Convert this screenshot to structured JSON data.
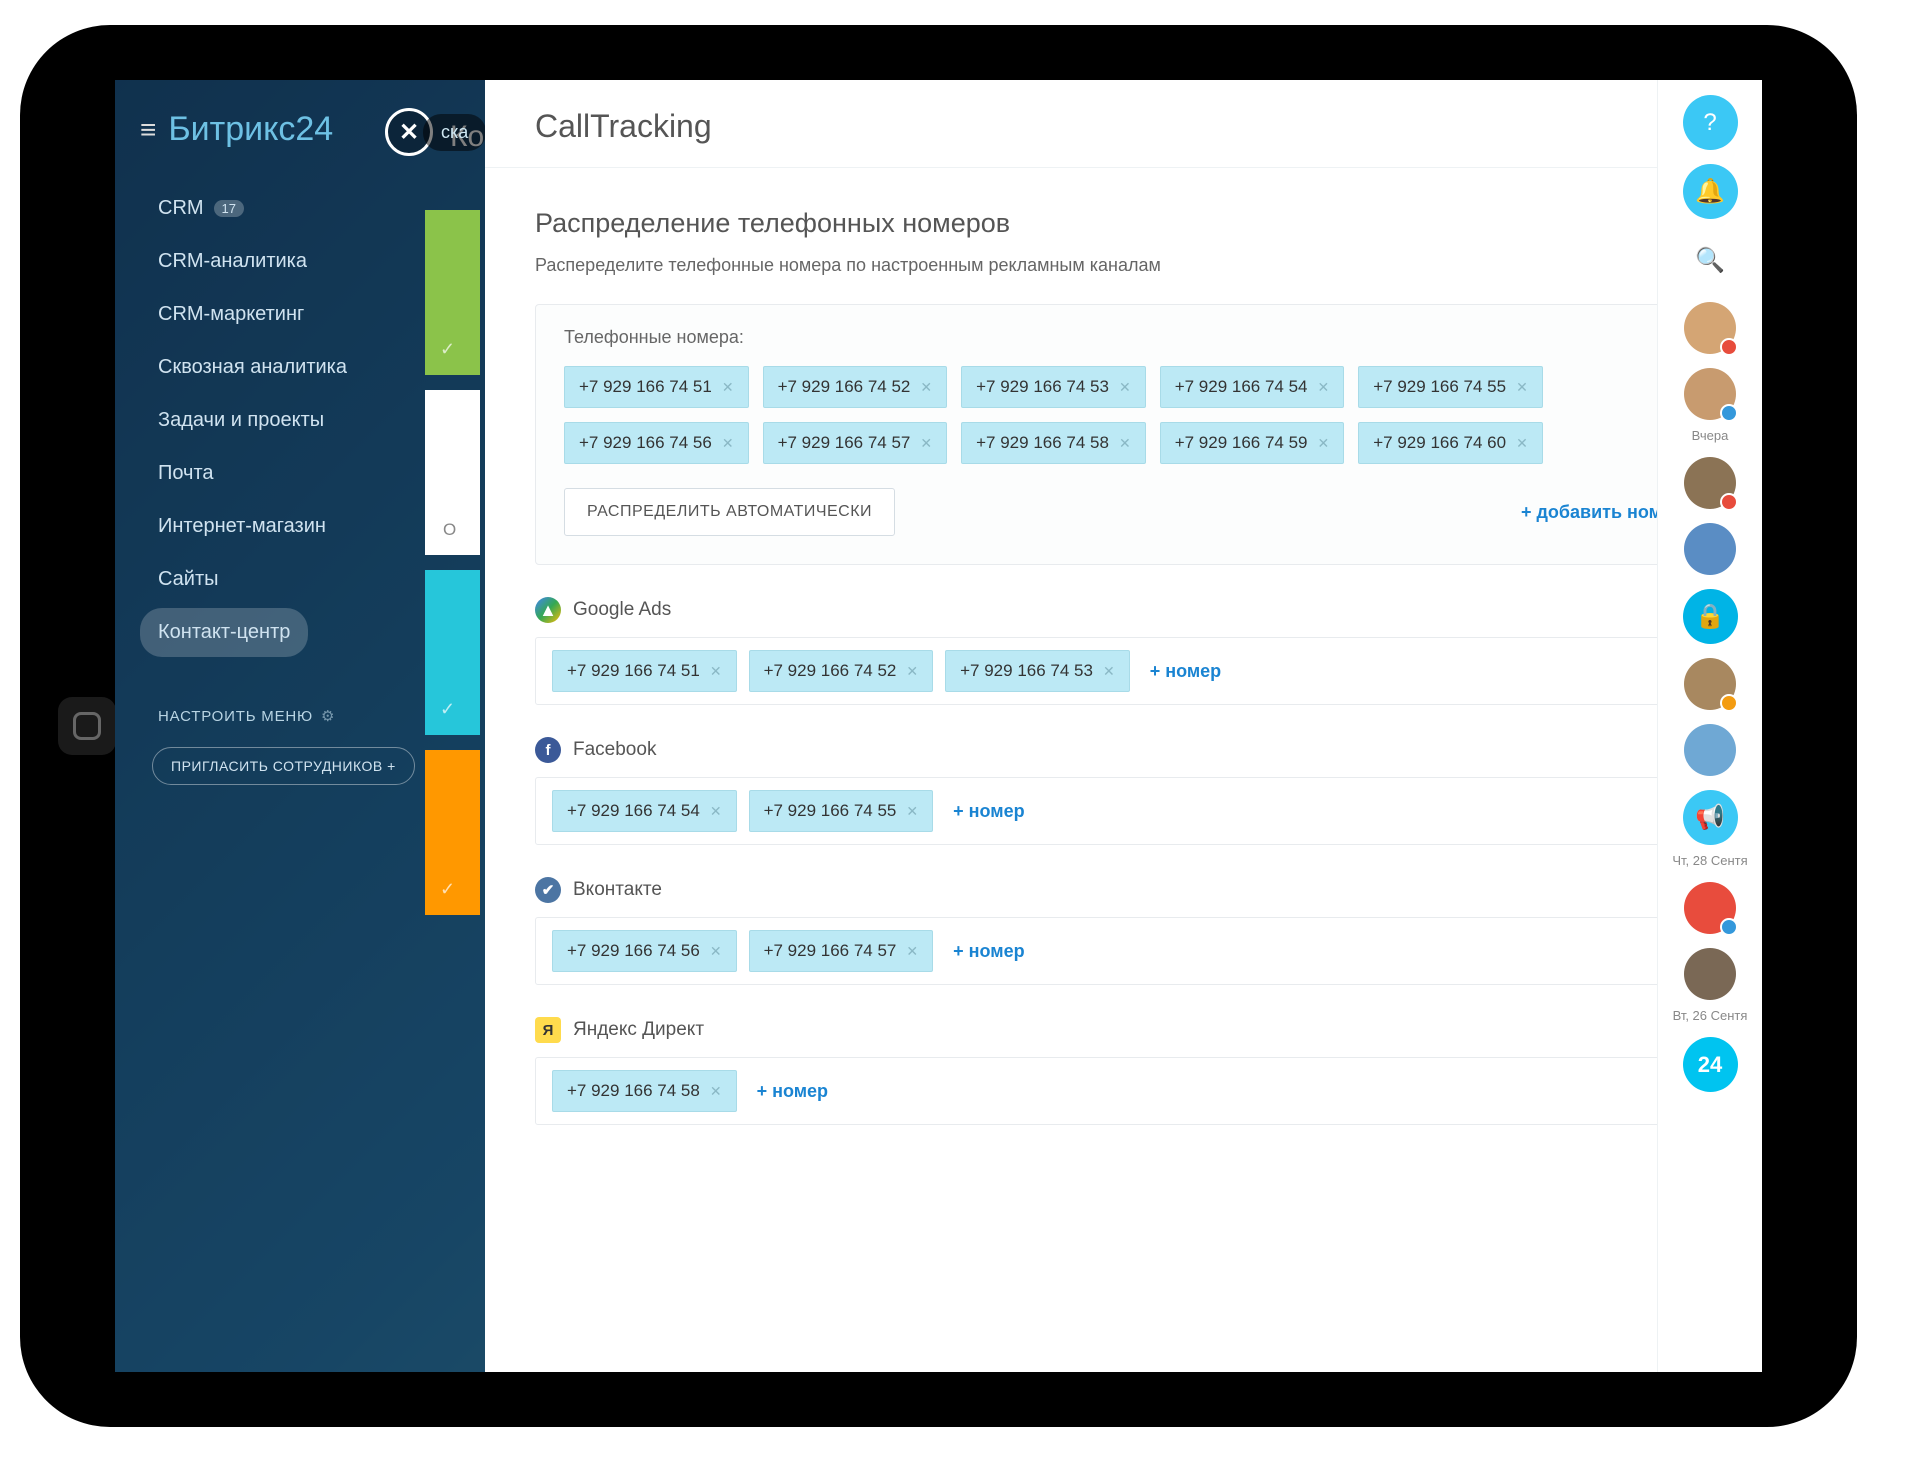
{
  "logo": {
    "brand": "Битрикс",
    "num": "24"
  },
  "nav": [
    {
      "label": "CRM",
      "badge": "17"
    },
    {
      "label": "CRM-аналитика"
    },
    {
      "label": "CRM-маркетинг"
    },
    {
      "label": "Сквозная аналитика"
    },
    {
      "label": "Задачи и проекты"
    },
    {
      "label": "Почта"
    },
    {
      "label": "Интернет-магазин"
    },
    {
      "label": "Сайты"
    },
    {
      "label": "Контакт-центр",
      "active": true
    }
  ],
  "sidebar": {
    "settings": "НАСТРОИТЬ МЕНЮ",
    "invite": "ПРИГЛАСИТЬ СОТРУДНИКОВ +"
  },
  "mid": {
    "header": "Кон",
    "close_tag": "ска"
  },
  "modal": {
    "title": "CallTracking",
    "section_title": "Распределение телефонных номеров",
    "section_sub": "Распеределите телефонные номера по настроенным рекламным каналам",
    "phone_label": "Телефонные номера:",
    "numbers": [
      "+7 929 166 74 51",
      "+7 929 166 74 52",
      "+7 929 166 74 53",
      "+7 929 166 74 54",
      "+7 929 166 74 55",
      "+7 929 166 74 56",
      "+7 929 166 74 57",
      "+7 929 166 74 58",
      "+7 929 166 74 59",
      "+7 929 166 74 60"
    ],
    "auto_btn": "РАСПРЕДЕЛИТЬ АВТОМАТИЧЕСКИ",
    "add_number": "+ добавить номер",
    "add_num_short": "+ номер",
    "channels": [
      {
        "name": "Google Ads",
        "icon": "gads",
        "nums": [
          "+7 929 166 74 51",
          "+7 929 166 74 52",
          "+7 929 166 74 53"
        ]
      },
      {
        "name": "Facebook",
        "icon": "fb",
        "nums": [
          "+7 929 166 74 54",
          "+7 929 166 74 55"
        ]
      },
      {
        "name": "Вконтакте",
        "icon": "vk",
        "nums": [
          "+7 929 166 74 56",
          "+7 929 166 74 57"
        ]
      },
      {
        "name": "Яндекс Директ",
        "icon": "yd",
        "nums": [
          "+7 929 166 74 58"
        ]
      }
    ]
  },
  "rail": {
    "t1": "Вчера",
    "t2": "Чт, 28 Сентя",
    "t3": "Вт, 26 Сентя",
    "b24": "24"
  }
}
